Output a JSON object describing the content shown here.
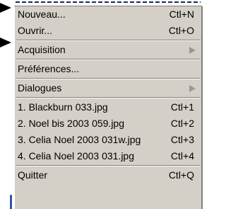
{
  "menu": {
    "items": [
      {
        "label": "Nouveau...",
        "shortcut": "Ctl+N"
      },
      {
        "label": "Ouvrir...",
        "shortcut": "Ctl+O"
      },
      {
        "label": "Acquisition",
        "submenu": true
      },
      {
        "label": "Préférences..."
      },
      {
        "label": "Dialogues",
        "submenu": true
      },
      {
        "label": "1. Blackburn 033.jpg",
        "shortcut": "Ctl+1"
      },
      {
        "label": "2. Noel bis 2003 059.jpg",
        "shortcut": "Ctl+2"
      },
      {
        "label": "3. Celia Noel 2003 031w.jpg",
        "shortcut": "Ctl+3"
      },
      {
        "label": "4. Celia Noel 2003 031.jpg",
        "shortcut": "Ctl+4"
      },
      {
        "label": "Quitter",
        "shortcut": "Ctl+Q"
      }
    ]
  },
  "colors": {
    "menu_bg": "#d4d0c8",
    "arrow": "#000000",
    "accent": "#3455a4"
  }
}
